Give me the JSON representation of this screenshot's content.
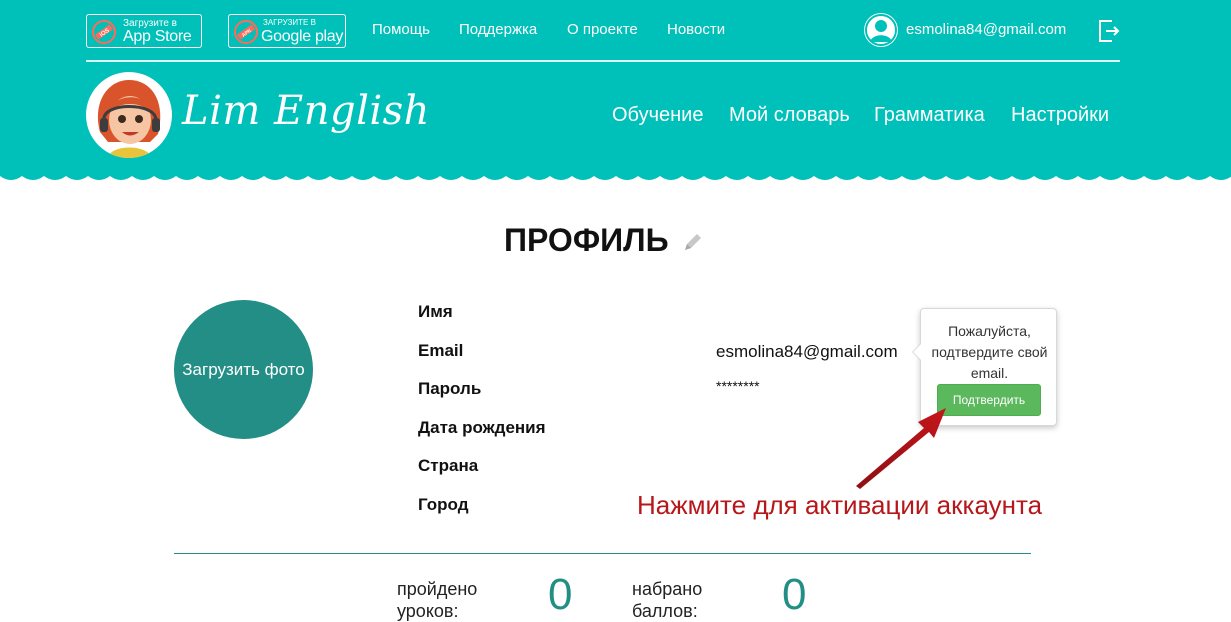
{
  "header": {
    "badges": [
      {
        "small": "Загрузите в",
        "big": "App Store",
        "icon": "app-store-icon"
      },
      {
        "small": "ЗАГРУЗИТЕ В",
        "big": "Google play",
        "icon": "google-play-icon"
      }
    ],
    "links": [
      "Помощь",
      "Поддержка",
      "О проекте",
      "Новости"
    ],
    "user_email": "esmolina84@gmail.com",
    "brand": "Lim English",
    "nav": [
      "Обучение",
      "Мой словарь",
      "Грамматика",
      "Настройки"
    ],
    "colors": {
      "header_bg": "#00c1b9",
      "accent": "#228e86"
    }
  },
  "profile": {
    "title": "ПРОФИЛЬ",
    "upload_photo_label": "Загрузить фото",
    "fields": [
      {
        "label": "Имя",
        "value": ""
      },
      {
        "label": "Email",
        "value": "esmolina84@gmail.com"
      },
      {
        "label": "Пароль",
        "value": "********"
      },
      {
        "label": "Дата рождения",
        "value": ""
      },
      {
        "label": "Страна",
        "value": ""
      },
      {
        "label": "Город",
        "value": ""
      }
    ]
  },
  "popover": {
    "text": "Пожалуйста, подтвердите свой email.",
    "button": "Подтвердить",
    "button_color": "#5cb85c"
  },
  "annotation": {
    "text": "Нажмите для активации аккаунта",
    "color": "#b5171a"
  },
  "stats": [
    {
      "label": "пройдено уроков:",
      "value": "0"
    },
    {
      "label": "набрано баллов:",
      "value": "0"
    }
  ]
}
